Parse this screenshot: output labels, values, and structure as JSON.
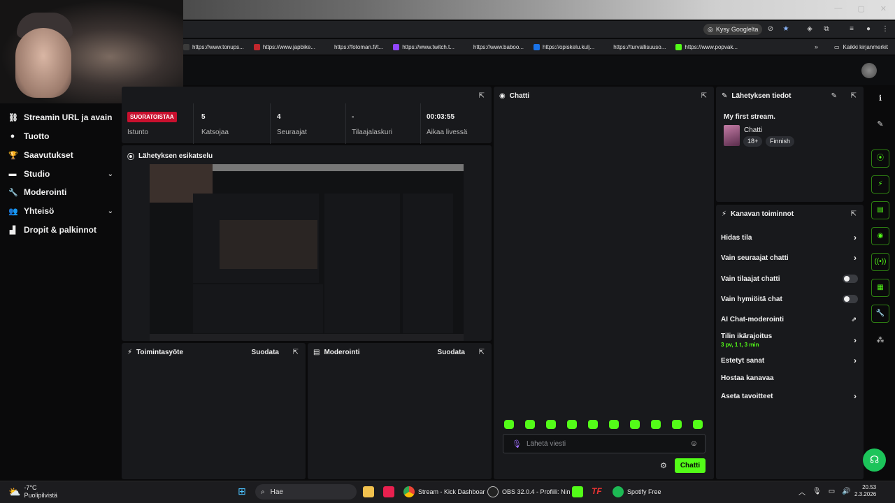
{
  "browser": {
    "kysy_label": "Kysy Googlelta",
    "bookmarks": [
      {
        "label": "https://www.tonups...",
        "color": "#3b3b3b"
      },
      {
        "label": "https://www.japbike...",
        "color": "#c1272d"
      },
      {
        "label": "https://fotoman.fi/t...",
        "color": "#202124"
      },
      {
        "label": "https://www.twitch.t...",
        "color": "#9146ff"
      },
      {
        "label": "https://www.baboo...",
        "color": "#202124"
      },
      {
        "label": "https://opiskelu.kulj...",
        "color": "#1a73e8"
      },
      {
        "label": "https://turvallisuuso...",
        "color": "#202124"
      },
      {
        "label": "https://www.popvak...",
        "color": "#53fc18"
      }
    ],
    "bookmarks_more": "»",
    "all_bookmarks": "Kaikki kirjanmerkit"
  },
  "sidebar": {
    "items": [
      {
        "label": "Streamin URL ja avain",
        "icon": "link-icon",
        "glyph": "⛓"
      },
      {
        "label": "Tuotto",
        "icon": "money-icon",
        "glyph": "●"
      },
      {
        "label": "Saavutukset",
        "icon": "trophy-icon",
        "glyph": "🏆"
      },
      {
        "label": "Studio",
        "icon": "studio-icon",
        "glyph": "▬"
      },
      {
        "label": "Moderointi",
        "icon": "wrench-icon",
        "glyph": "🔧"
      },
      {
        "label": "Yhteisö",
        "icon": "people-icon",
        "glyph": "👥"
      },
      {
        "label": "Dropit & palkinnot",
        "icon": "gift-icon",
        "glyph": "▟"
      }
    ]
  },
  "stats": {
    "live_badge": "SUORATOISTAA",
    "session_label": "Istunto",
    "viewers_value": "5",
    "viewers_label": "Katsojaa",
    "followers_value": "4",
    "followers_label": "Seuraajat",
    "subs_value": "-",
    "subs_label": "Tilaajalaskuri",
    "uptime_value": "00:03:55",
    "uptime_label": "Aikaa livessä"
  },
  "preview": {
    "title": "Lähetyksen esikatselu"
  },
  "activity_feed": {
    "title": "Toimintasyöte",
    "filter": "Suodata"
  },
  "moderation": {
    "title": "Moderointi",
    "filter": "Suodata"
  },
  "chat": {
    "title": "Chatti",
    "input_placeholder": "Lähetä viesti",
    "send_label": "Chatti"
  },
  "stream_info": {
    "title": "Lähetyksen tiedot",
    "stream_title": "My first stream.",
    "category": "Chatti",
    "tags": [
      "18+",
      "Finnish"
    ]
  },
  "channel_actions": {
    "title": "Kanavan toiminnot",
    "slow_mode": "Hidas tila",
    "followers_chat": "Vain seuraajat chatti",
    "subs_chat": "Vain tilaajat chatti",
    "emote_chat": "Vain hymiöitä chat",
    "ai_mod": "AI Chat-moderointi",
    "account_age": "Tilin ikärajoitus",
    "account_age_value": "3 pv, 1 t, 3 min",
    "banned_words": "Estetyt sanat",
    "host": "Hostaa kanavaa",
    "goals": "Aseta tavoitteet"
  },
  "taskbar": {
    "weather_temp": "-7°C",
    "weather_desc": "Puolipilvistä",
    "search": "Hae",
    "chrome_label": "Stream - Kick Dashboar",
    "obs_label": "OBS 32.0.4 - Profiili: Nin",
    "spotify_label": "Spotify Free",
    "time": "20.53",
    "date": "2.3.2026"
  },
  "colors": {
    "accent": "#53fc18",
    "live": "#c8102e",
    "panel": "#18191c"
  }
}
